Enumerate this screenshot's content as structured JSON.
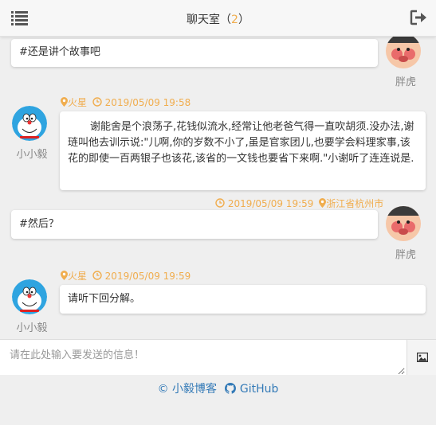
{
  "header": {
    "title": "聊天室",
    "count_open": "（",
    "count": "2",
    "count_close": "）"
  },
  "messages": [
    {
      "side": "right",
      "user": "胖虎",
      "text": "#还是讲个故事吧"
    },
    {
      "side": "left",
      "user": "小小毅",
      "location": "火星",
      "time": "2019/05/09 19:58",
      "text": "谢能舍是个浪荡子,花钱似流水,经常让他老爸气得一直吹胡须.没办法,谢琏叫他去训示说:\"儿啊,你的岁数不小了,虽是官家团儿,也要学会料理家事,该花的即使一百两银子也该花,该省的一文钱也要省下来啊.\"小谢听了连连说是."
    },
    {
      "side": "right",
      "user": "胖虎",
      "location": "浙江省杭州市",
      "time": "2019/05/09 19:59",
      "text": "#然后？"
    },
    {
      "side": "left",
      "user": "小小毅",
      "location": "火星",
      "time": "2019/05/09 19:59",
      "text": "请听下回分解。"
    }
  ],
  "input": {
    "placeholder": "请在此处输入要发送的信息！"
  },
  "footer": {
    "blog": "© 小毅博客",
    "github": "GitHub"
  },
  "colors": {
    "accent": "#f0ad4e",
    "link": "#337ab7"
  },
  "icons": [
    "menu-icon",
    "logout-icon",
    "location-icon",
    "clock-icon",
    "image-icon",
    "github-icon"
  ]
}
